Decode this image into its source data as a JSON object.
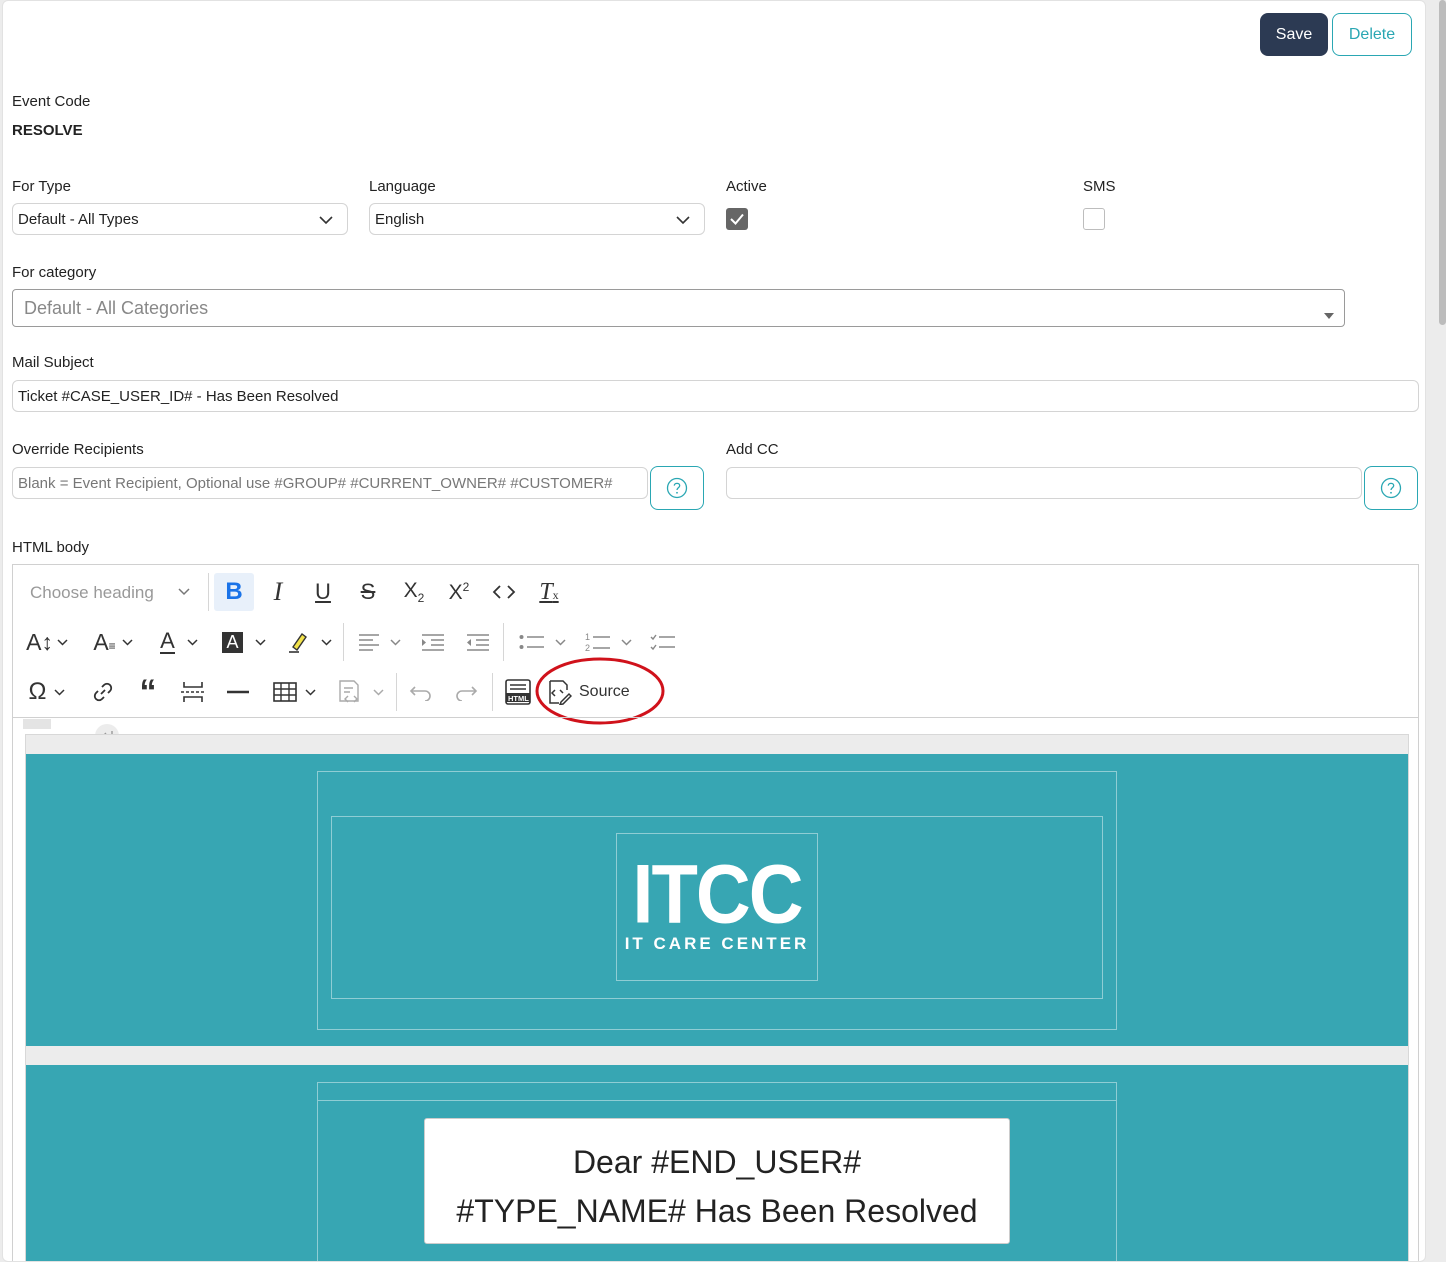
{
  "actions": {
    "save_label": "Save",
    "delete_label": "Delete"
  },
  "event_code": {
    "label": "Event Code",
    "value": "RESOLVE"
  },
  "for_type": {
    "label": "For Type",
    "value": "Default - All Types"
  },
  "language": {
    "label": "Language",
    "value": "English"
  },
  "active": {
    "label": "Active",
    "checked": true
  },
  "sms": {
    "label": "SMS",
    "checked": false
  },
  "for_category": {
    "label": "For category",
    "value": "Default - All Categories"
  },
  "mail_subject": {
    "label": "Mail Subject",
    "value": "Ticket #CASE_USER_ID# - Has Been Resolved"
  },
  "override_recipients": {
    "label": "Override Recipients",
    "placeholder": "Blank = Event Recipient, Optional use #GROUP# #CURRENT_OWNER# #CUSTOMER#"
  },
  "add_cc": {
    "label": "Add CC",
    "value": ""
  },
  "html_body": {
    "label": "HTML body",
    "heading_select": "Choose heading",
    "source_label": "Source",
    "toolbar_icons": [
      "bold-icon",
      "italic-icon",
      "underline-icon",
      "strikethrough-icon",
      "subscript-icon",
      "superscript-icon",
      "code-icon",
      "remove-format-icon",
      "font-size-icon",
      "font-family-icon",
      "font-color-icon",
      "background-color-icon",
      "highlight-icon",
      "align-icon",
      "indent-icon",
      "outdent-icon",
      "bulleted-list-icon",
      "numbered-list-icon",
      "todo-list-icon",
      "special-characters-icon",
      "link-icon",
      "blockquote-icon",
      "page-break-icon",
      "horizontal-line-icon",
      "table-icon",
      "insert-template-icon",
      "undo-icon",
      "redo-icon",
      "html-embed-icon",
      "source-icon"
    ]
  },
  "email_preview": {
    "logo_main": "ITCC",
    "logo_sub": "IT CARE CENTER",
    "greeting": "Dear #END_USER#",
    "message": "#TYPE_NAME# Has Been Resolved"
  },
  "colors": {
    "brand_teal": "#37a6b3",
    "accent": "#2aa7b3",
    "primary_button": "#2c3a53",
    "highlight_circle": "#d0121b"
  }
}
